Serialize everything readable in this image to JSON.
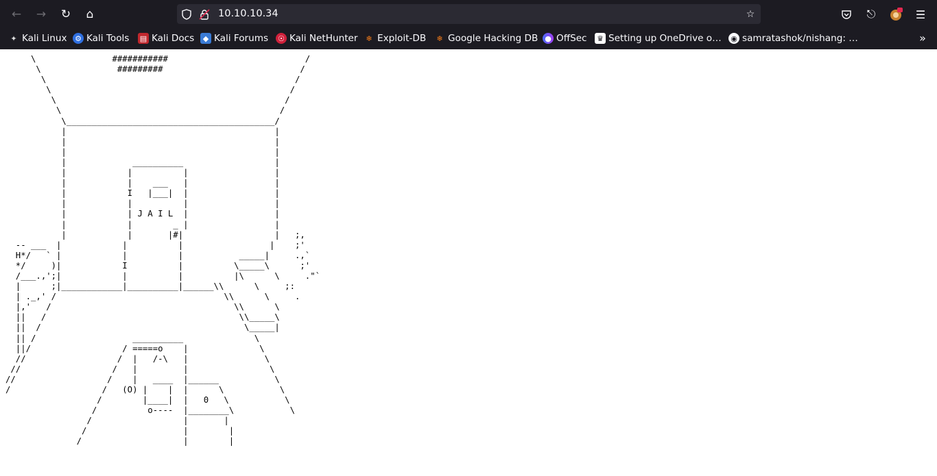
{
  "browser": {
    "url": "10.10.10.34",
    "toolbar_icons": [
      "back-icon",
      "forward-icon",
      "reload-icon",
      "home-icon",
      "shield-icon",
      "insecure-lock-icon",
      "bookmark-star-icon",
      "pocket-icon",
      "extensions-icon",
      "account-icon",
      "menu-icon"
    ],
    "bookmarks": [
      {
        "label": "Kali Linux",
        "icon": "kali-dragon-icon"
      },
      {
        "label": "Kali Tools",
        "icon": "kali-tools-icon"
      },
      {
        "label": "Kali Docs",
        "icon": "kali-docs-icon"
      },
      {
        "label": "Kali Forums",
        "icon": "kali-forums-icon"
      },
      {
        "label": "Kali NetHunter",
        "icon": "nethunter-icon"
      },
      {
        "label": "Exploit-DB",
        "icon": "exploitdb-icon"
      },
      {
        "label": "Google Hacking DB",
        "icon": "ghdb-icon"
      },
      {
        "label": "OffSec",
        "icon": "offsec-icon"
      },
      {
        "label": "Setting up OneDrive o…",
        "icon": "onedrive-icon"
      },
      {
        "label": "samratashok/nishang: …",
        "icon": "github-icon"
      }
    ]
  },
  "page": {
    "ascii_art": "     \\               ###########                           /\n      \\               #########                           /\n       \\                                                 /\n        \\                                               /\n         \\                                             /\n          \\                                           /\n           \\_________________________________________/\n           |                                         |\n           |                                         |\n           |                                         |\n           |             __________                  |\n           |            |          |                 |\n           |            |    ___   |                 |\n           |            I   |___|  |                 |\n           |            |          |                 |\n           |            | J A I L  |                 |\n           |            |        _ |                 |\n           |            |       |#|                  |   ;,\n  -- ___  |            |          |                 |    ;'\n  H*/   ` |            |          |           _____|     .,`\n  */     )|            I          |          \\_____\\      ;'\n  /___.,';|            |          |          |\\      \\     .\"`\n  |      ;|____________|__________|______\\\\      \\     ;:\n  | ._,' /                                 \\\\      \\     .\n  |,'   /                                    \\\\      \\\n  ||   /                                      \\\\_____\\\n  ||  /                                        \\_____|\n  || /                   __________              \\\n  ||/                  / =====o    |              \\\n  //                  /  |   /-\\   |               \\\n //                  /   |         |                \\\n//                  /    |   ____  |______           \\\n/                  /   (O) |    |  |      \\           \\\n                  /        |____|  |   0   \\           \\\n                 /          o----  |________\\           \\\n                /                  |       |\n               /                   |        |\n              /                    |        |"
  }
}
